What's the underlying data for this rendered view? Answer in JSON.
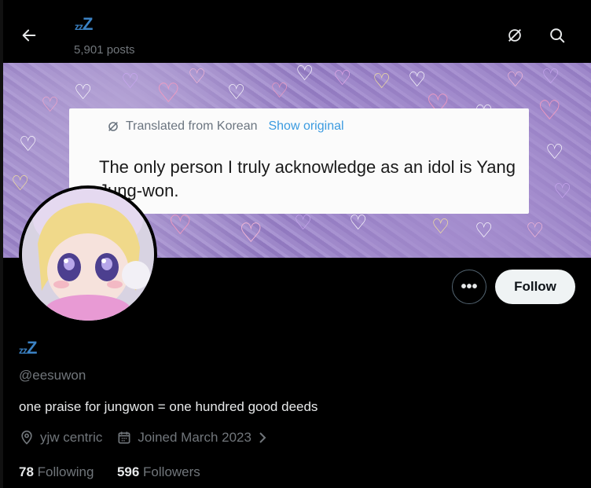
{
  "header": {
    "title_small": "z",
    "title_mid": "z",
    "title_big": "Z",
    "posts_count": "5,901 posts",
    "back_icon": "arrow-left-icon",
    "filter_icon": "circle-slash-icon",
    "search_icon": "search-icon"
  },
  "banner": {
    "translated_label": "Translated from Korean",
    "show_original_label": "Show original",
    "quote_text": "The only person I truly acknowledge as an idol is Yang Jung-won."
  },
  "profile": {
    "name_small": "z",
    "name_mid": "z",
    "name_big": "Z",
    "handle": "@eesuwon",
    "bio": "one praise for jungwon = one hundred good deeds",
    "location": "yjw centric",
    "joined": "Joined March 2023",
    "following_count": "78",
    "following_label": "Following",
    "followers_count": "596",
    "followers_label": "Followers"
  },
  "actions": {
    "more_label": "•••",
    "follow_label": "Follow"
  },
  "colors": {
    "accent_blue": "#3b82c4",
    "link_blue": "#3b9be0",
    "muted_text": "#71767b",
    "banner_purple": "#9c86c8"
  }
}
